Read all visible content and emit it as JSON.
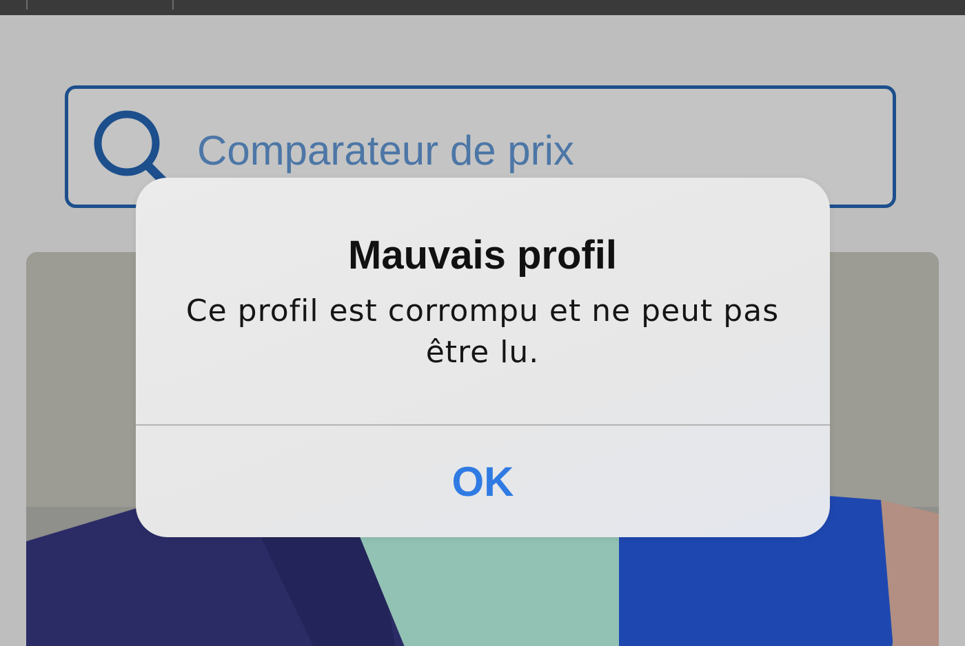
{
  "search": {
    "placeholder": "Comparateur de prix",
    "icon": "search-icon",
    "border_color": "#1c4f8c",
    "text_color": "#4c76a6"
  },
  "alert": {
    "title": "Mauvais profil",
    "message": "Ce profil est corrompu et ne peut pas être lu.",
    "ok_label": "OK",
    "ok_color": "#2f7be3"
  }
}
